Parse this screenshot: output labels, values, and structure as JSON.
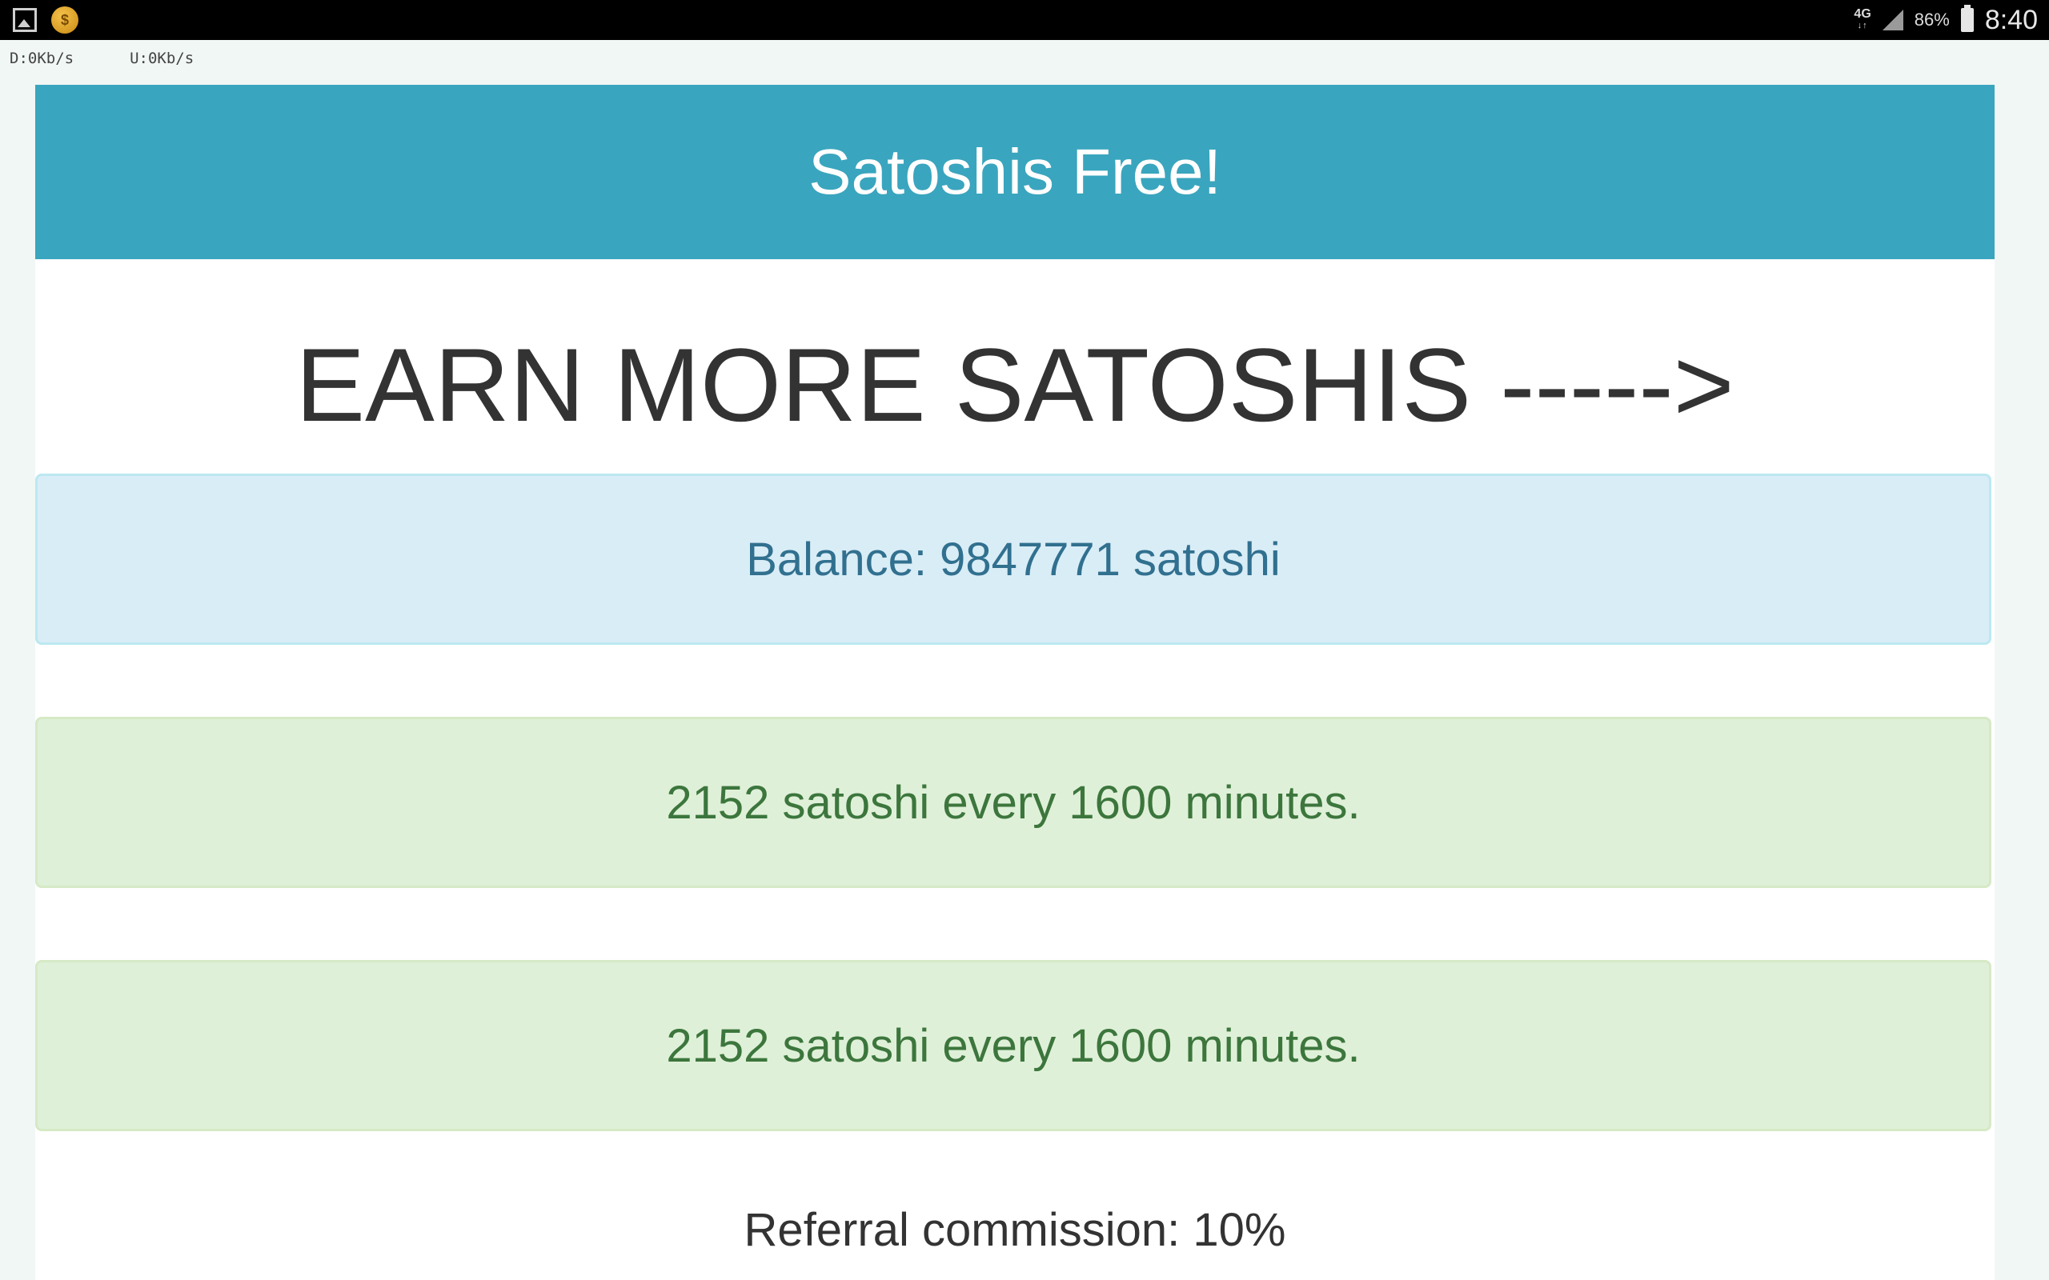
{
  "status_bar": {
    "network": "4G",
    "battery": "86%",
    "time": "8:40",
    "icons": [
      "gallery-icon",
      "coin-app-icon",
      "signal-icon",
      "battery-icon"
    ]
  },
  "net_speed": {
    "download": "D:0Kb/s",
    "upload": "U:0Kb/s"
  },
  "page": {
    "banner_title": "Satoshis Free!",
    "headline": "EARN MORE SATOSHIS ----->",
    "balance": "Balance: 9847771 satoshi",
    "rewards": [
      "2152 satoshi every 1600 minutes.",
      "2152 satoshi every 1600 minutes."
    ],
    "referral": "Referral commission: 10%"
  },
  "colors": {
    "banner": "#3aa5be",
    "info_bg": "#d9edf7",
    "info_text": "#31708f",
    "success_bg": "#dff0d8",
    "success_text": "#3c763d"
  }
}
